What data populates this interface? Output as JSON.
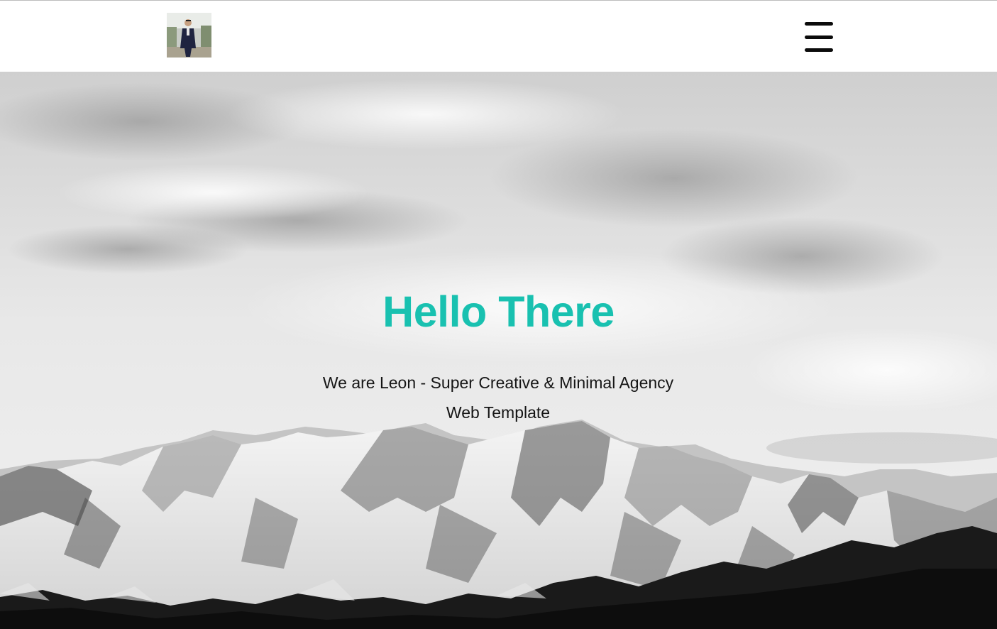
{
  "header": {
    "logo_alt": "Profile photo logo",
    "menu_icon": "hamburger-menu-icon"
  },
  "hero": {
    "title": "Hello There",
    "subtitle": "We are Leon - Super Creative & Minimal Agency Web Template",
    "background": "snowy mountain range under cloudy sky, black and white"
  },
  "colors": {
    "accent": "#19c1b0",
    "text": "#151515",
    "header_bg": "#ffffff"
  }
}
